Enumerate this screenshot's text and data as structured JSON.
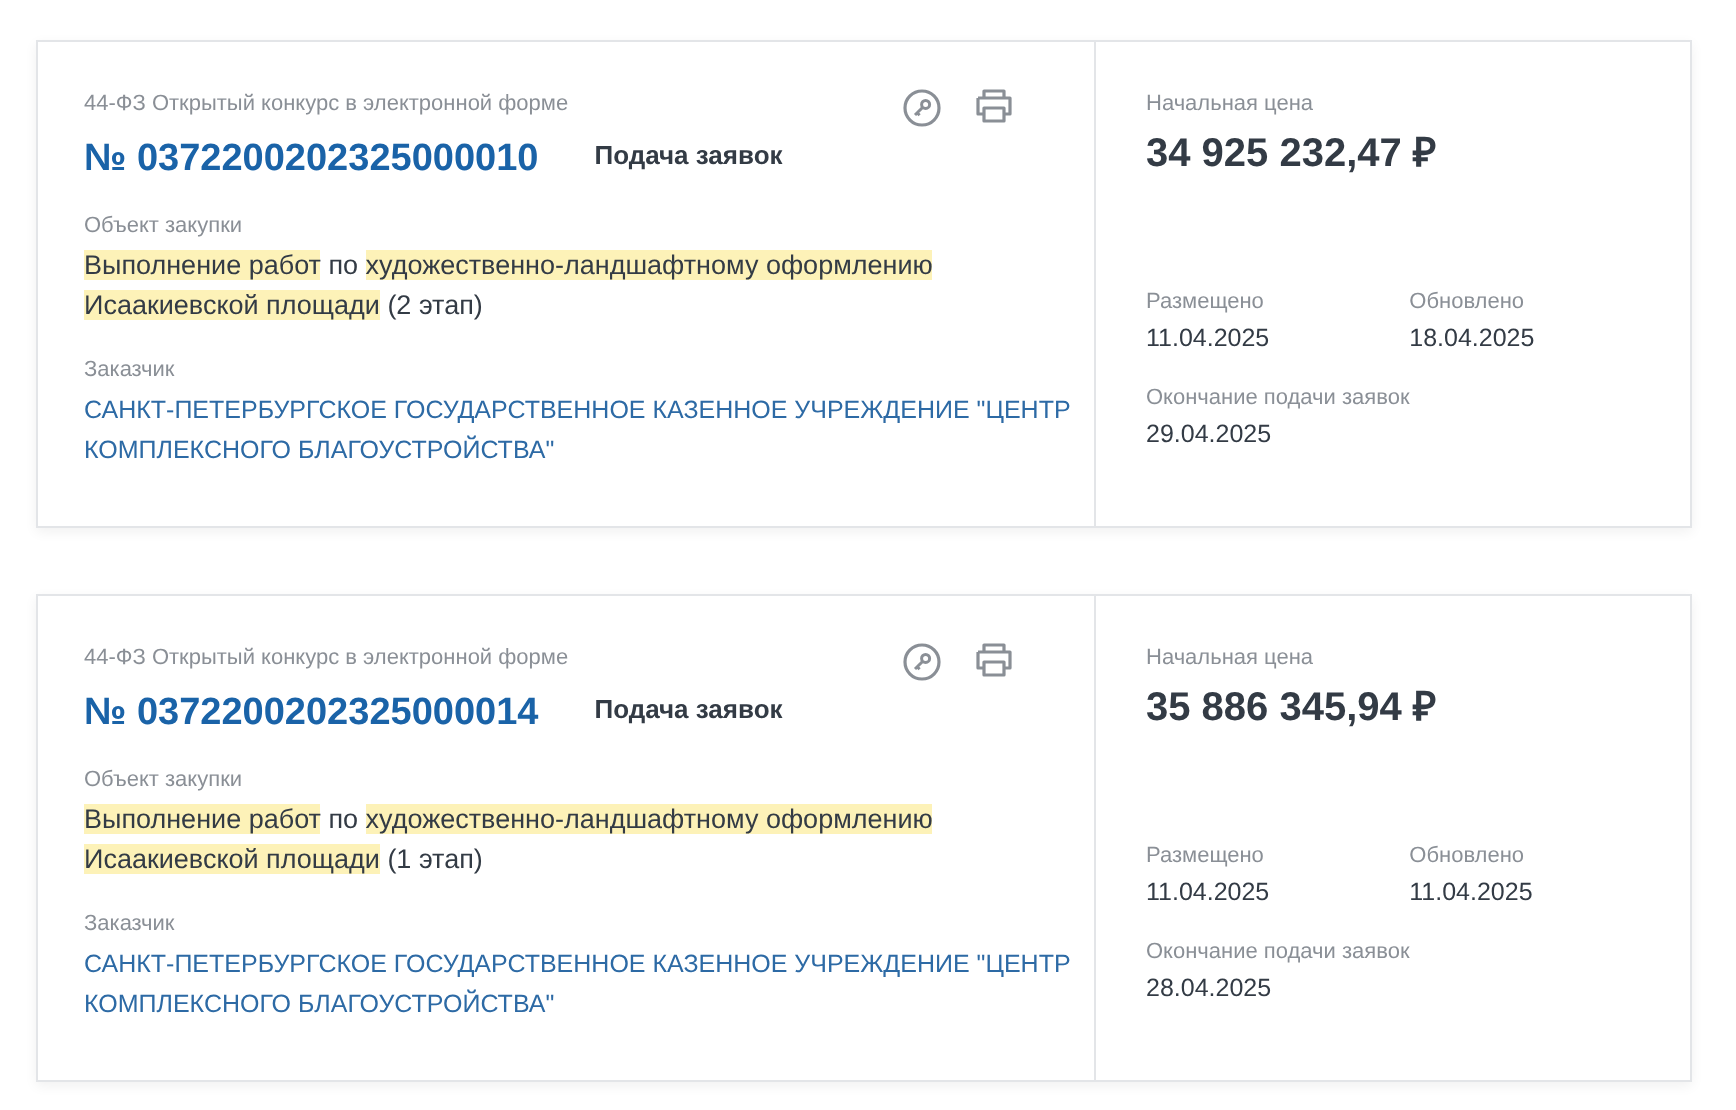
{
  "tenders": [
    {
      "type": "44-ФЗ Открытый конкурс в электронной форме",
      "number": "№ 0372200202325000010",
      "status": "Подача заявок",
      "object_label": "Объект закупки",
      "object": [
        {
          "text": "Выполнение работ",
          "highlighted": true
        },
        {
          "text": " по ",
          "highlighted": false
        },
        {
          "text": "художественно-ландшафтному оформлению Исаакиевской площади",
          "highlighted": true
        },
        {
          "text": " (2 этап)",
          "highlighted": false
        }
      ],
      "customer_label": "Заказчик",
      "customer": "САНКТ-ПЕТЕРБУРГСКОЕ ГОСУДАРСТВЕННОЕ КАЗЕННОЕ УЧРЕЖДЕНИЕ \"ЦЕНТР КОМПЛЕКСНОГО БЛАГОУСТРОЙСТВА\"",
      "price_label": "Начальная цена",
      "price": "34 925 232,47 ₽",
      "posted_label": "Размещено",
      "posted": "11.04.2025",
      "updated_label": "Обновлено",
      "updated": "18.04.2025",
      "deadline_label": "Окончание подачи заявок",
      "deadline": "29.04.2025"
    },
    {
      "type": "44-ФЗ Открытый конкурс в электронной форме",
      "number": "№ 0372200202325000014",
      "status": "Подача заявок",
      "object_label": "Объект закупки",
      "object": [
        {
          "text": "Выполнение работ",
          "highlighted": true
        },
        {
          "text": " по ",
          "highlighted": false
        },
        {
          "text": "художественно-ландшафтному оформлению Исаакиевской площади",
          "highlighted": true
        },
        {
          "text": " (1 этап)",
          "highlighted": false
        }
      ],
      "customer_label": "Заказчик",
      "customer": "САНКТ-ПЕТЕРБУРГСКОЕ ГОСУДАРСТВЕННОЕ КАЗЕННОЕ УЧРЕЖДЕНИЕ \"ЦЕНТР КОМПЛЕКСНОГО БЛАГОУСТРОЙСТВА\"",
      "price_label": "Начальная цена",
      "price": "35 886 345,94 ₽",
      "posted_label": "Размещено",
      "posted": "11.04.2025",
      "updated_label": "Обновлено",
      "updated": "11.04.2025",
      "deadline_label": "Окончание подачи заявок",
      "deadline": "28.04.2025"
    }
  ]
}
